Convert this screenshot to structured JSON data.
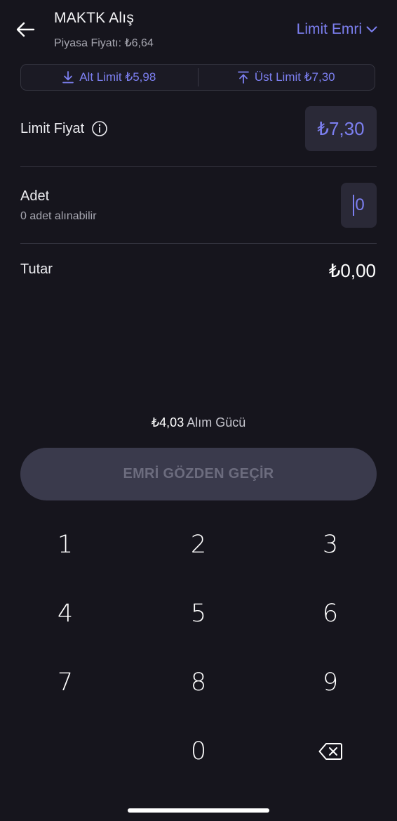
{
  "header": {
    "title": "MAKTK Alış",
    "subtitle": "Piyasa Fiyatı: ₺6,64",
    "order_type": "Limit Emri"
  },
  "limits": {
    "lower": "Alt Limit ₺5,98",
    "upper": "Üst Limit ₺7,30"
  },
  "form": {
    "limit_price_label": "Limit Fiyat",
    "limit_price_value": "₺7,30",
    "quantity_label": "Adet",
    "quantity_sub": "0 adet alınabilir",
    "quantity_value": "0",
    "amount_label": "Tutar",
    "amount_value": "₺0,00"
  },
  "buying_power": {
    "value": "₺4,03",
    "label": "Alım Gücü"
  },
  "review_button": "EMRİ GÖZDEN GEÇİR",
  "keypad": {
    "keys": [
      "1",
      "2",
      "3",
      "4",
      "5",
      "6",
      "7",
      "8",
      "9",
      "0"
    ]
  },
  "colors": {
    "background": "#16151d",
    "accent": "#7c7ff0",
    "field_bg": "#2a2937",
    "button_disabled": "#3a3a4c"
  },
  "icons": {
    "back": "arrow-left-icon",
    "dropdown": "chevron-down-icon",
    "lower_limit": "download-arrow-icon",
    "upper_limit": "upload-arrow-icon",
    "info": "info-circle-icon",
    "backspace": "backspace-icon"
  }
}
